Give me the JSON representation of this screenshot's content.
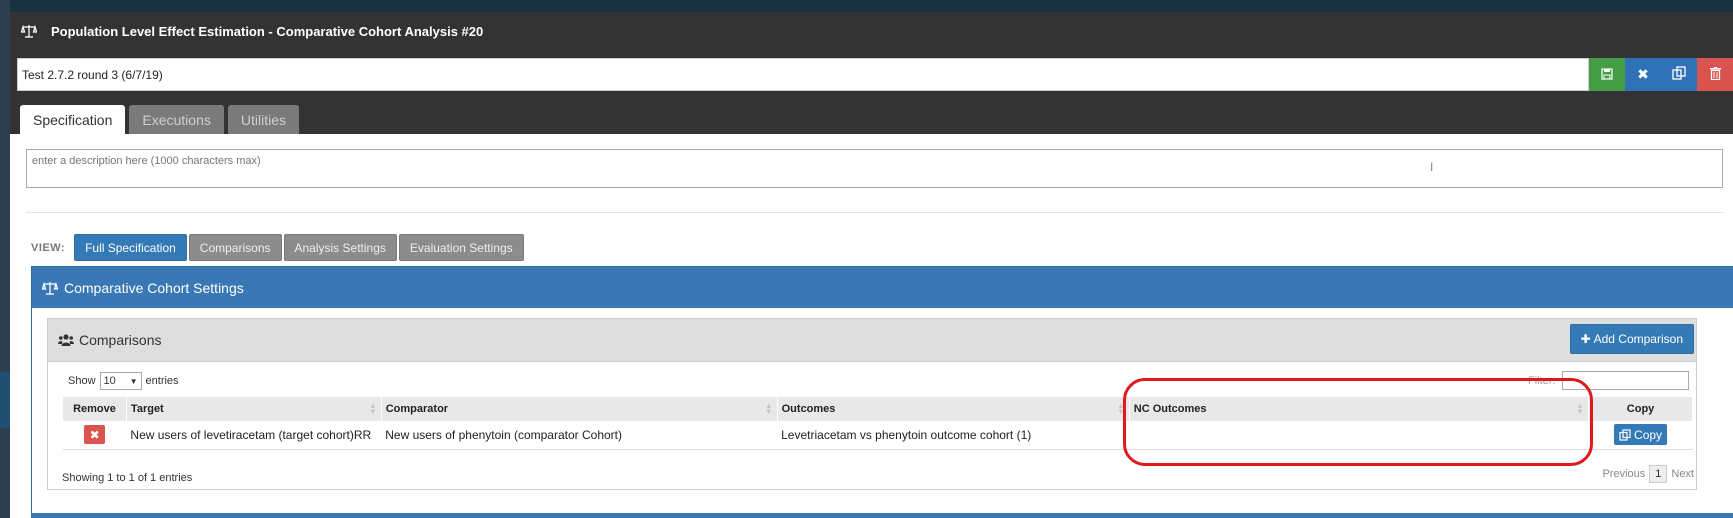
{
  "header": {
    "title": "Population Level Effect Estimation - Comparative Cohort Analysis #20",
    "analysis_name": "Test 2.7.2 round 3 (6/7/19)"
  },
  "tabs": [
    {
      "label": "Specification",
      "active": true
    },
    {
      "label": "Executions",
      "active": false
    },
    {
      "label": "Utilities",
      "active": false
    }
  ],
  "description": {
    "placeholder": "enter a description here (1000 characters max)"
  },
  "view": {
    "label": "VIEW:",
    "buttons": [
      {
        "label": "Full Specification",
        "active": true
      },
      {
        "label": "Comparisons",
        "active": false
      },
      {
        "label": "Analysis Settings",
        "active": false
      },
      {
        "label": "Evaluation Settings",
        "active": false
      }
    ]
  },
  "cohort_panel": {
    "title": "Comparative Cohort Settings"
  },
  "comparisons": {
    "title": "Comparisons",
    "add_button": "Add Comparison",
    "show_label": "Show",
    "entries_value": "10",
    "entries_label": "entries",
    "filter_label": "Filter:",
    "columns": [
      "Remove",
      "Target",
      "Comparator",
      "Outcomes",
      "NC Outcomes",
      "Copy"
    ],
    "rows": [
      {
        "target": "New users of levetiracetam (target cohort)RR",
        "comparator": "New users of phenytoin (comparator Cohort)",
        "outcomes": "Levetriacetam vs phenytoin outcome cohort (1)",
        "nc_outcomes": "",
        "copy_label": "Copy"
      }
    ],
    "showing_text": "Showing 1 to 1 of 1 entries",
    "pager": {
      "previous": "Previous",
      "page": "1",
      "next": "Next"
    }
  },
  "colors": {
    "header_bg": "#333333",
    "primary": "#337ab7",
    "success": "#449d44",
    "danger": "#d9534f",
    "highlight": "#e0191f"
  }
}
